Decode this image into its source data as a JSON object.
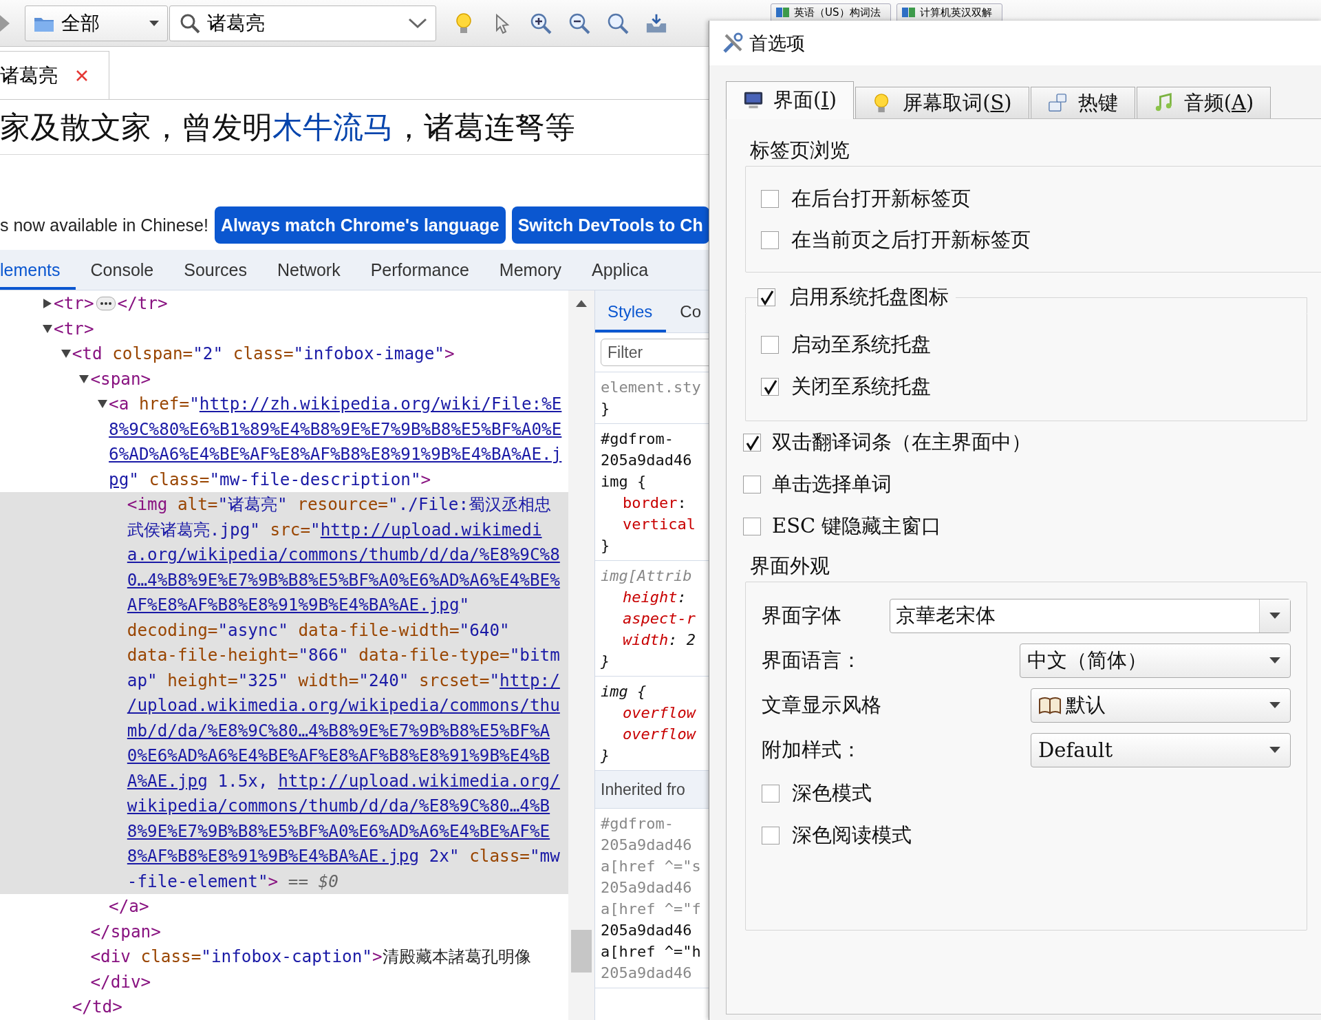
{
  "toolbar": {
    "scope": {
      "value": "全部"
    },
    "search": {
      "value": "诸葛亮"
    },
    "dictionary_tabs": [
      {
        "label": "英语（US）构词法"
      },
      {
        "label": "计算机英汉双解"
      }
    ]
  },
  "page_tabs": [
    {
      "label": "诸葛亮",
      "selected": true
    }
  ],
  "page_text": [
    {
      "kind": "text",
      "text": "家及散文家，曾发明"
    },
    {
      "kind": "link",
      "text": "木牛流马"
    },
    {
      "kind": "text",
      "text": "，诸葛连弩等"
    }
  ],
  "devtools": {
    "banner": {
      "message": "s now available in Chinese!",
      "buttons": [
        "Always match Chrome's language",
        "Switch DevTools to Ch"
      ]
    },
    "tabs": [
      {
        "label": "lements",
        "selected": true
      },
      {
        "label": "Console",
        "selected": false
      },
      {
        "label": "Sources",
        "selected": false
      },
      {
        "label": "Network",
        "selected": false
      },
      {
        "label": "Performance",
        "selected": false
      },
      {
        "label": "Memory",
        "selected": false
      },
      {
        "label": "Applica",
        "selected": false
      }
    ],
    "dom_tree": [
      {
        "expanded": false,
        "selected": false,
        "lines": [
          [
            {
              "kind": "tag",
              "text": "<tr>"
            },
            {
              "kind": "ellipsis"
            },
            {
              "kind": "tag",
              "text": "</tr>"
            }
          ]
        ]
      },
      {
        "expanded": true,
        "selected": false,
        "lines": [
          [
            {
              "kind": "tag",
              "text": "<tr>"
            }
          ]
        ],
        "children": [
          {
            "expanded": true,
            "selected": false,
            "lines": [
              [
                {
                  "kind": "tag",
                  "text": "<td"
                },
                {
                  "kind": "attr",
                  "text": " colspan="
                },
                {
                  "kind": "value",
                  "text": "\"2\""
                },
                {
                  "kind": "attr",
                  "text": " class="
                },
                {
                  "kind": "value",
                  "text": "\"infobox-image\""
                },
                {
                  "kind": "tag",
                  "text": ">"
                }
              ]
            ],
            "close": "</td>",
            "children": [
              {
                "expanded": true,
                "selected": false,
                "lines": [
                  [
                    {
                      "kind": "tag",
                      "text": "<span>"
                    }
                  ]
                ],
                "close": "</span>",
                "children": [
                  {
                    "expanded": true,
                    "selected": false,
                    "close": "</a>",
                    "lines": [
                      [
                        {
                          "kind": "tag",
                          "text": "<a"
                        },
                        {
                          "kind": "attr",
                          "text": " href="
                        },
                        {
                          "kind": "value",
                          "text": "\""
                        },
                        {
                          "kind": "link",
                          "text": "http://zh.wikipedia.org/wiki/File:%E"
                        }
                      ],
                      [
                        {
                          "kind": "link",
                          "text": "8%9C%80%E6%B1%89%E4%B8%9E%E7%9B%B8%E5%BF%A0%E"
                        }
                      ],
                      [
                        {
                          "kind": "link",
                          "text": "6%AD%A6%E4%BE%AF%E8%AF%B8%E8%91%9B%E4%BA%AE.j"
                        }
                      ],
                      [
                        {
                          "kind": "link",
                          "text": "pg"
                        },
                        {
                          "kind": "value",
                          "text": "\""
                        },
                        {
                          "kind": "attr",
                          "text": " class="
                        },
                        {
                          "kind": "value",
                          "text": "\"mw-file-description\""
                        },
                        {
                          "kind": "tag",
                          "text": ">"
                        }
                      ]
                    ],
                    "children": [
                      {
                        "selected": true,
                        "lines": [
                          [
                            {
                              "kind": "tag",
                              "text": "<img"
                            },
                            {
                              "kind": "attr",
                              "text": " alt="
                            },
                            {
                              "kind": "value",
                              "text": "\"诸葛亮\""
                            },
                            {
                              "kind": "attr",
                              "text": " resource="
                            },
                            {
                              "kind": "value",
                              "text": "\"./File:蜀汉丞相忠"
                            }
                          ],
                          [
                            {
                              "kind": "value",
                              "text": "武侯诸葛亮.jpg\""
                            },
                            {
                              "kind": "attr",
                              "text": " src="
                            },
                            {
                              "kind": "value",
                              "text": "\""
                            },
                            {
                              "kind": "link",
                              "text": "http://upload.wikimedi"
                            }
                          ],
                          [
                            {
                              "kind": "link",
                              "text": "a.org/wikipedia/commons/thumb/d/da/%E8%9C%8"
                            }
                          ],
                          [
                            {
                              "kind": "link",
                              "text": "0…4%B8%9E%E7%9B%B8%E5%BF%A0%E6%AD%A6%E4%BE%"
                            }
                          ],
                          [
                            {
                              "kind": "link",
                              "text": "AF%E8%AF%B8%E8%91%9B%E4%BA%AE.jpg"
                            },
                            {
                              "kind": "value",
                              "text": "\""
                            }
                          ],
                          [
                            {
                              "kind": "attr",
                              "text": "decoding="
                            },
                            {
                              "kind": "value",
                              "text": "\"async\""
                            },
                            {
                              "kind": "attr",
                              "text": " data-file-width="
                            },
                            {
                              "kind": "value",
                              "text": "\"640\""
                            }
                          ],
                          [
                            {
                              "kind": "attr",
                              "text": "data-file-height="
                            },
                            {
                              "kind": "value",
                              "text": "\"866\""
                            },
                            {
                              "kind": "attr",
                              "text": " data-file-type="
                            },
                            {
                              "kind": "value",
                              "text": "\"bitm"
                            }
                          ],
                          [
                            {
                              "kind": "value",
                              "text": "ap\""
                            },
                            {
                              "kind": "attr",
                              "text": " height="
                            },
                            {
                              "kind": "value",
                              "text": "\"325\""
                            },
                            {
                              "kind": "attr",
                              "text": " width="
                            },
                            {
                              "kind": "value",
                              "text": "\"240\""
                            },
                            {
                              "kind": "attr",
                              "text": " srcset="
                            },
                            {
                              "kind": "value",
                              "text": "\""
                            },
                            {
                              "kind": "link",
                              "text": "http:/"
                            }
                          ],
                          [
                            {
                              "kind": "link",
                              "text": "/upload.wikimedia.org/wikipedia/commons/thu"
                            }
                          ],
                          [
                            {
                              "kind": "link",
                              "text": "mb/d/da/%E8%9C%80…4%B8%9E%E7%9B%B8%E5%BF%A"
                            }
                          ],
                          [
                            {
                              "kind": "link",
                              "text": "0%E6%AD%A6%E4%BE%AF%E8%AF%B8%E8%91%9B%E4%B"
                            }
                          ],
                          [
                            {
                              "kind": "link",
                              "text": "A%AE.jpg"
                            },
                            {
                              "kind": "value",
                              "text": " 1.5x, "
                            },
                            {
                              "kind": "link",
                              "text": "http://upload.wikimedia.org/"
                            }
                          ],
                          [
                            {
                              "kind": "link",
                              "text": "wikipedia/commons/thumb/d/da/%E8%9C%80…4%B"
                            }
                          ],
                          [
                            {
                              "kind": "link",
                              "text": "8%9E%E7%9B%B8%E5%BF%A0%E6%AD%A6%E4%BE%AF%E"
                            }
                          ],
                          [
                            {
                              "kind": "link",
                              "text": "8%AF%B8%E8%91%9B%E4%BA%AE.jpg"
                            },
                            {
                              "kind": "value",
                              "text": " 2x\""
                            },
                            {
                              "kind": "attr",
                              "text": " class="
                            },
                            {
                              "kind": "value",
                              "text": "\"mw"
                            }
                          ],
                          [
                            {
                              "kind": "value",
                              "text": "-file-element\""
                            },
                            {
                              "kind": "tag",
                              "text": ">"
                            },
                            {
                              "kind": "dim",
                              "text": " == $0"
                            }
                          ]
                        ]
                      }
                    ]
                  }
                ]
              },
              {
                "selected": false,
                "close": "</div>",
                "lines": [
                  [
                    {
                      "kind": "tag",
                      "text": "<div"
                    },
                    {
                      "kind": "attr",
                      "text": " class="
                    },
                    {
                      "kind": "value",
                      "text": "\"infobox-caption\""
                    },
                    {
                      "kind": "tag",
                      "text": ">"
                    },
                    {
                      "kind": "text",
                      "text": "清殿藏本諸葛孔明像"
                    }
                  ]
                ]
              }
            ]
          }
        ]
      }
    ],
    "styles_tabs": [
      {
        "label": "Styles",
        "selected": true
      },
      {
        "label": "Co",
        "selected": false
      }
    ],
    "styles_filter": {
      "placeholder": "Filter"
    },
    "style_rules": [
      {
        "kind": "rule",
        "lines": [
          [
            {
              "kind": "dim",
              "text": "element.sty"
            }
          ],
          [
            {
              "kind": "plain",
              "text": "}"
            }
          ]
        ]
      },
      {
        "kind": "rule",
        "lines": [
          [
            {
              "kind": "plain",
              "text": "#gdfrom-"
            }
          ],
          [
            {
              "kind": "plain",
              "text": "205a9dad46"
            }
          ],
          [
            {
              "kind": "plain",
              "text": "img {"
            }
          ],
          [
            {
              "kind": "prop",
              "text": "border"
            },
            {
              "kind": "plain",
              "text": ":"
            }
          ],
          [
            {
              "kind": "prop",
              "text": "vertical"
            }
          ],
          [
            {
              "kind": "plain",
              "text": "}"
            }
          ]
        ]
      },
      {
        "kind": "rule",
        "lines": [
          [
            {
              "kind": "dim-italic",
              "text": "img[Attrib"
            }
          ],
          [
            {
              "kind": "prop-italic",
              "text": "height"
            },
            {
              "kind": "italic",
              "text": ":"
            }
          ],
          [
            {
              "kind": "prop-italic",
              "text": "aspect-r"
            }
          ],
          [
            {
              "kind": "prop-italic",
              "text": "width"
            },
            {
              "kind": "italic",
              "text": ": 2"
            }
          ],
          [
            {
              "kind": "italic",
              "text": "}"
            }
          ]
        ]
      },
      {
        "kind": "rule",
        "lines": [
          [
            {
              "kind": "italic",
              "text": "img {"
            }
          ],
          [
            {
              "kind": "prop-italic",
              "text": "overflow"
            }
          ],
          [
            {
              "kind": "prop-italic",
              "text": "overflow"
            }
          ],
          [
            {
              "kind": "italic",
              "text": "}"
            }
          ]
        ]
      },
      {
        "kind": "header",
        "text": "Inherited fro"
      },
      {
        "kind": "rule",
        "lines": [
          [
            {
              "kind": "dim",
              "text": "#gdfrom-"
            }
          ],
          [
            {
              "kind": "dim",
              "text": "205a9dad46"
            }
          ],
          [
            {
              "kind": "dim",
              "text": "a[href ^=\"s"
            }
          ],
          [
            {
              "kind": "dim",
              "text": "205a9dad46"
            }
          ],
          [
            {
              "kind": "dim",
              "text": "a[href ^=\"f"
            }
          ],
          [
            {
              "kind": "plain",
              "text": "205a9dad46"
            }
          ],
          [
            {
              "kind": "plain",
              "text": "a[href ^=\"h"
            }
          ],
          [
            {
              "kind": "dim",
              "text": "205a9dad46"
            }
          ]
        ]
      }
    ]
  },
  "dialog": {
    "title": "首选项",
    "tabs": [
      {
        "label": "界面(",
        "access_key": "I",
        "label_end": ")",
        "selected": true
      },
      {
        "label": "屏幕取词(",
        "access_key": "S",
        "label_end": ")",
        "selected": false
      },
      {
        "label": "热键",
        "selected": false
      },
      {
        "label": "音频(",
        "access_key": "A",
        "label_end": ")",
        "selected": false
      }
    ],
    "items": [
      {
        "kind": "heading",
        "text": "标签页浏览"
      },
      {
        "kind": "group",
        "items": [
          {
            "kind": "checkbox",
            "label": "在后台打开新标签页",
            "checked": false
          },
          {
            "kind": "checkbox",
            "label": "在当前页之后打开新标签页",
            "checked": false
          }
        ]
      },
      {
        "kind": "check-group",
        "label": "启用系统托盘图标",
        "checked": true,
        "items": [
          {
            "kind": "checkbox",
            "label": "启动至系统托盘",
            "checked": false
          },
          {
            "kind": "checkbox",
            "label": "关闭至系统托盘",
            "checked": true
          }
        ]
      },
      {
        "kind": "checkbox",
        "label": "双击翻译词条（在主界面中）",
        "checked": true
      },
      {
        "kind": "checkbox",
        "label": "单击选择单词",
        "checked": false
      },
      {
        "kind": "checkbox",
        "label": "ESC 键隐藏主窗口",
        "checked": false
      },
      {
        "kind": "heading",
        "text": "界面外观"
      },
      {
        "kind": "group",
        "items": [
          {
            "kind": "editable-combo",
            "label": "界面字体",
            "value": "京華老宋体"
          },
          {
            "kind": "combo",
            "label": "界面语言：",
            "value": "中文（简体）"
          },
          {
            "kind": "icon-combo",
            "label": "文章显示风格",
            "value": "默认"
          },
          {
            "kind": "combo",
            "label": "附加样式：",
            "value": "Default"
          },
          {
            "kind": "checkbox",
            "label": "深色模式",
            "checked": false
          },
          {
            "kind": "checkbox",
            "label": "深色阅读模式",
            "checked": false
          }
        ]
      }
    ]
  }
}
